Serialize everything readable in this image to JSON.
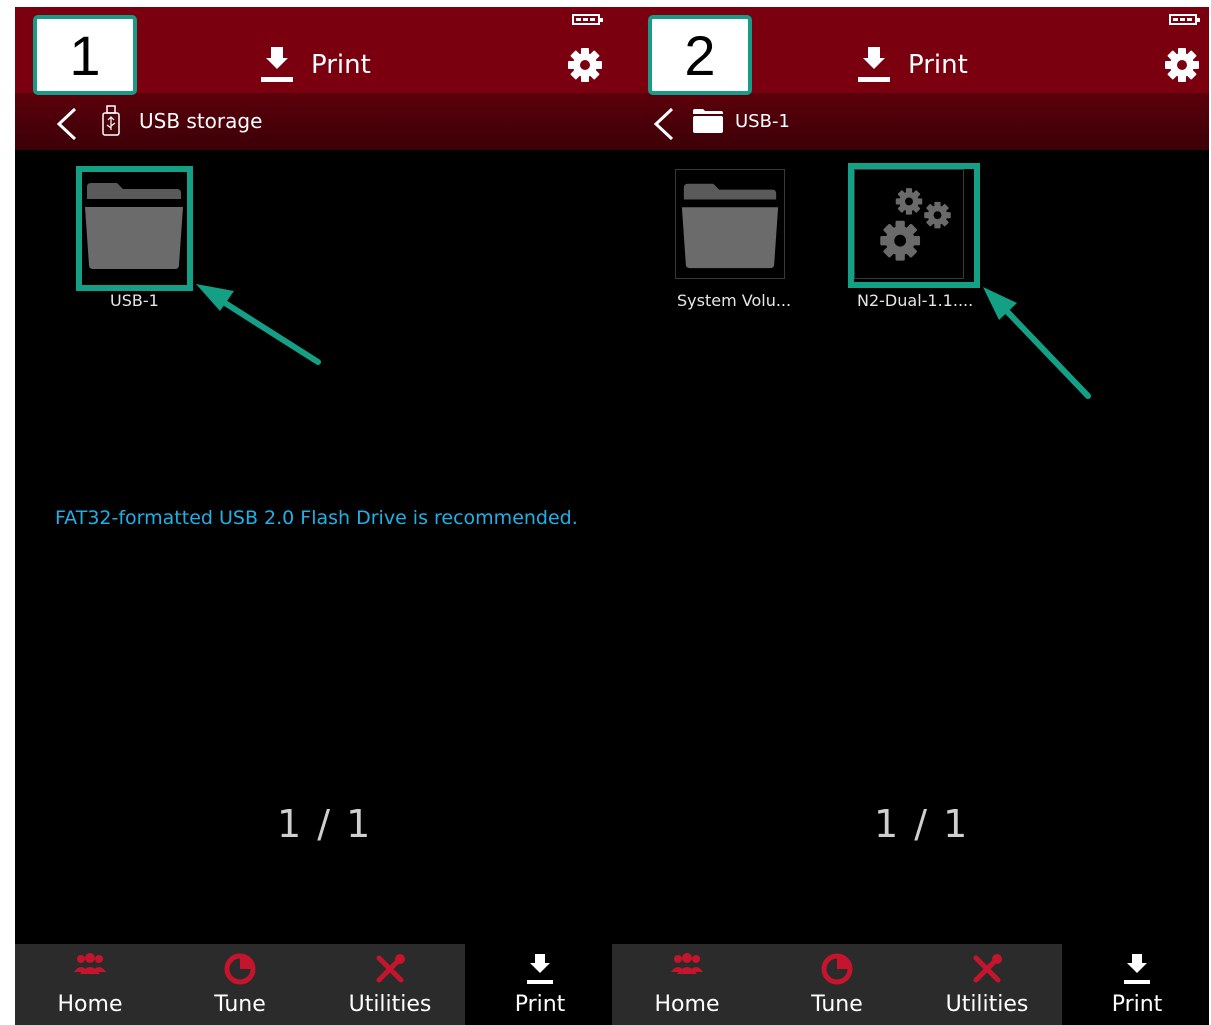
{
  "colors": {
    "topbar": "#7a000f",
    "accent_red": "#c4152c",
    "hint_blue": "#1fb0e8",
    "annotation_teal": "#13a085"
  },
  "panels": [
    {
      "badge": "1",
      "header_title": "Print",
      "breadcrumb": {
        "icon": "usb-icon",
        "label": "USB storage"
      },
      "files": [
        {
          "icon": "folder-icon",
          "label": "USB-1"
        }
      ],
      "hint": "FAT32-formatted USB 2.0 Flash Drive is recommended.",
      "pager": "1 / 1",
      "nav": [
        {
          "label": "Home",
          "icon": "home-icon"
        },
        {
          "label": "Tune",
          "icon": "tune-icon"
        },
        {
          "label": "Utilities",
          "icon": "utilities-icon"
        },
        {
          "label": "Print",
          "icon": "print-icon",
          "active": true
        }
      ]
    },
    {
      "badge": "2",
      "header_title": "Print",
      "breadcrumb": {
        "icon": "folder-icon",
        "label": "USB-1"
      },
      "files": [
        {
          "icon": "folder-icon",
          "label": "System Volu..."
        },
        {
          "icon": "gears-icon",
          "label": "N2-Dual-1.1...."
        }
      ],
      "pager": "1 / 1",
      "nav": [
        {
          "label": "Home",
          "icon": "home-icon"
        },
        {
          "label": "Tune",
          "icon": "tune-icon"
        },
        {
          "label": "Utilities",
          "icon": "utilities-icon"
        },
        {
          "label": "Print",
          "icon": "print-icon",
          "active": true
        }
      ]
    }
  ]
}
